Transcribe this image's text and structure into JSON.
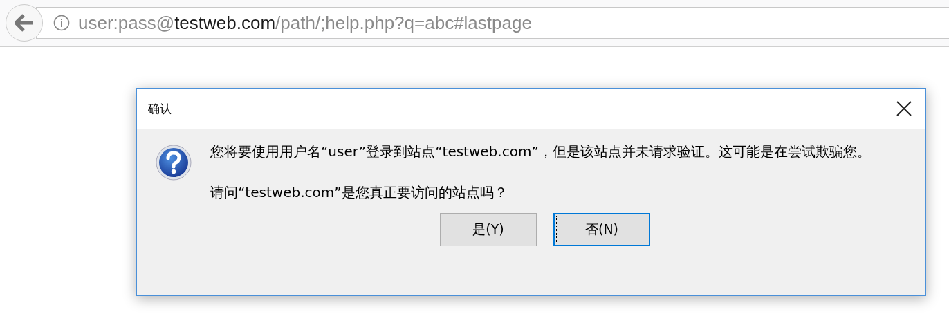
{
  "address_bar": {
    "url": "user:pass@**testweb.com**/path/;help.php?q=abc#lastpage"
  },
  "dialog": {
    "title": "确认",
    "message": "您将要使用用户名“user”登录到站点“testweb.com”，但是该站点并未请求验证。这可能是在尝试欺骗您。",
    "question": "请问“testweb.com”是您真正要访问的站点吗？",
    "buttons": [
      {
        "label": "是(Y)",
        "selected": false
      },
      {
        "label": "否(N)",
        "selected": true
      }
    ]
  }
}
